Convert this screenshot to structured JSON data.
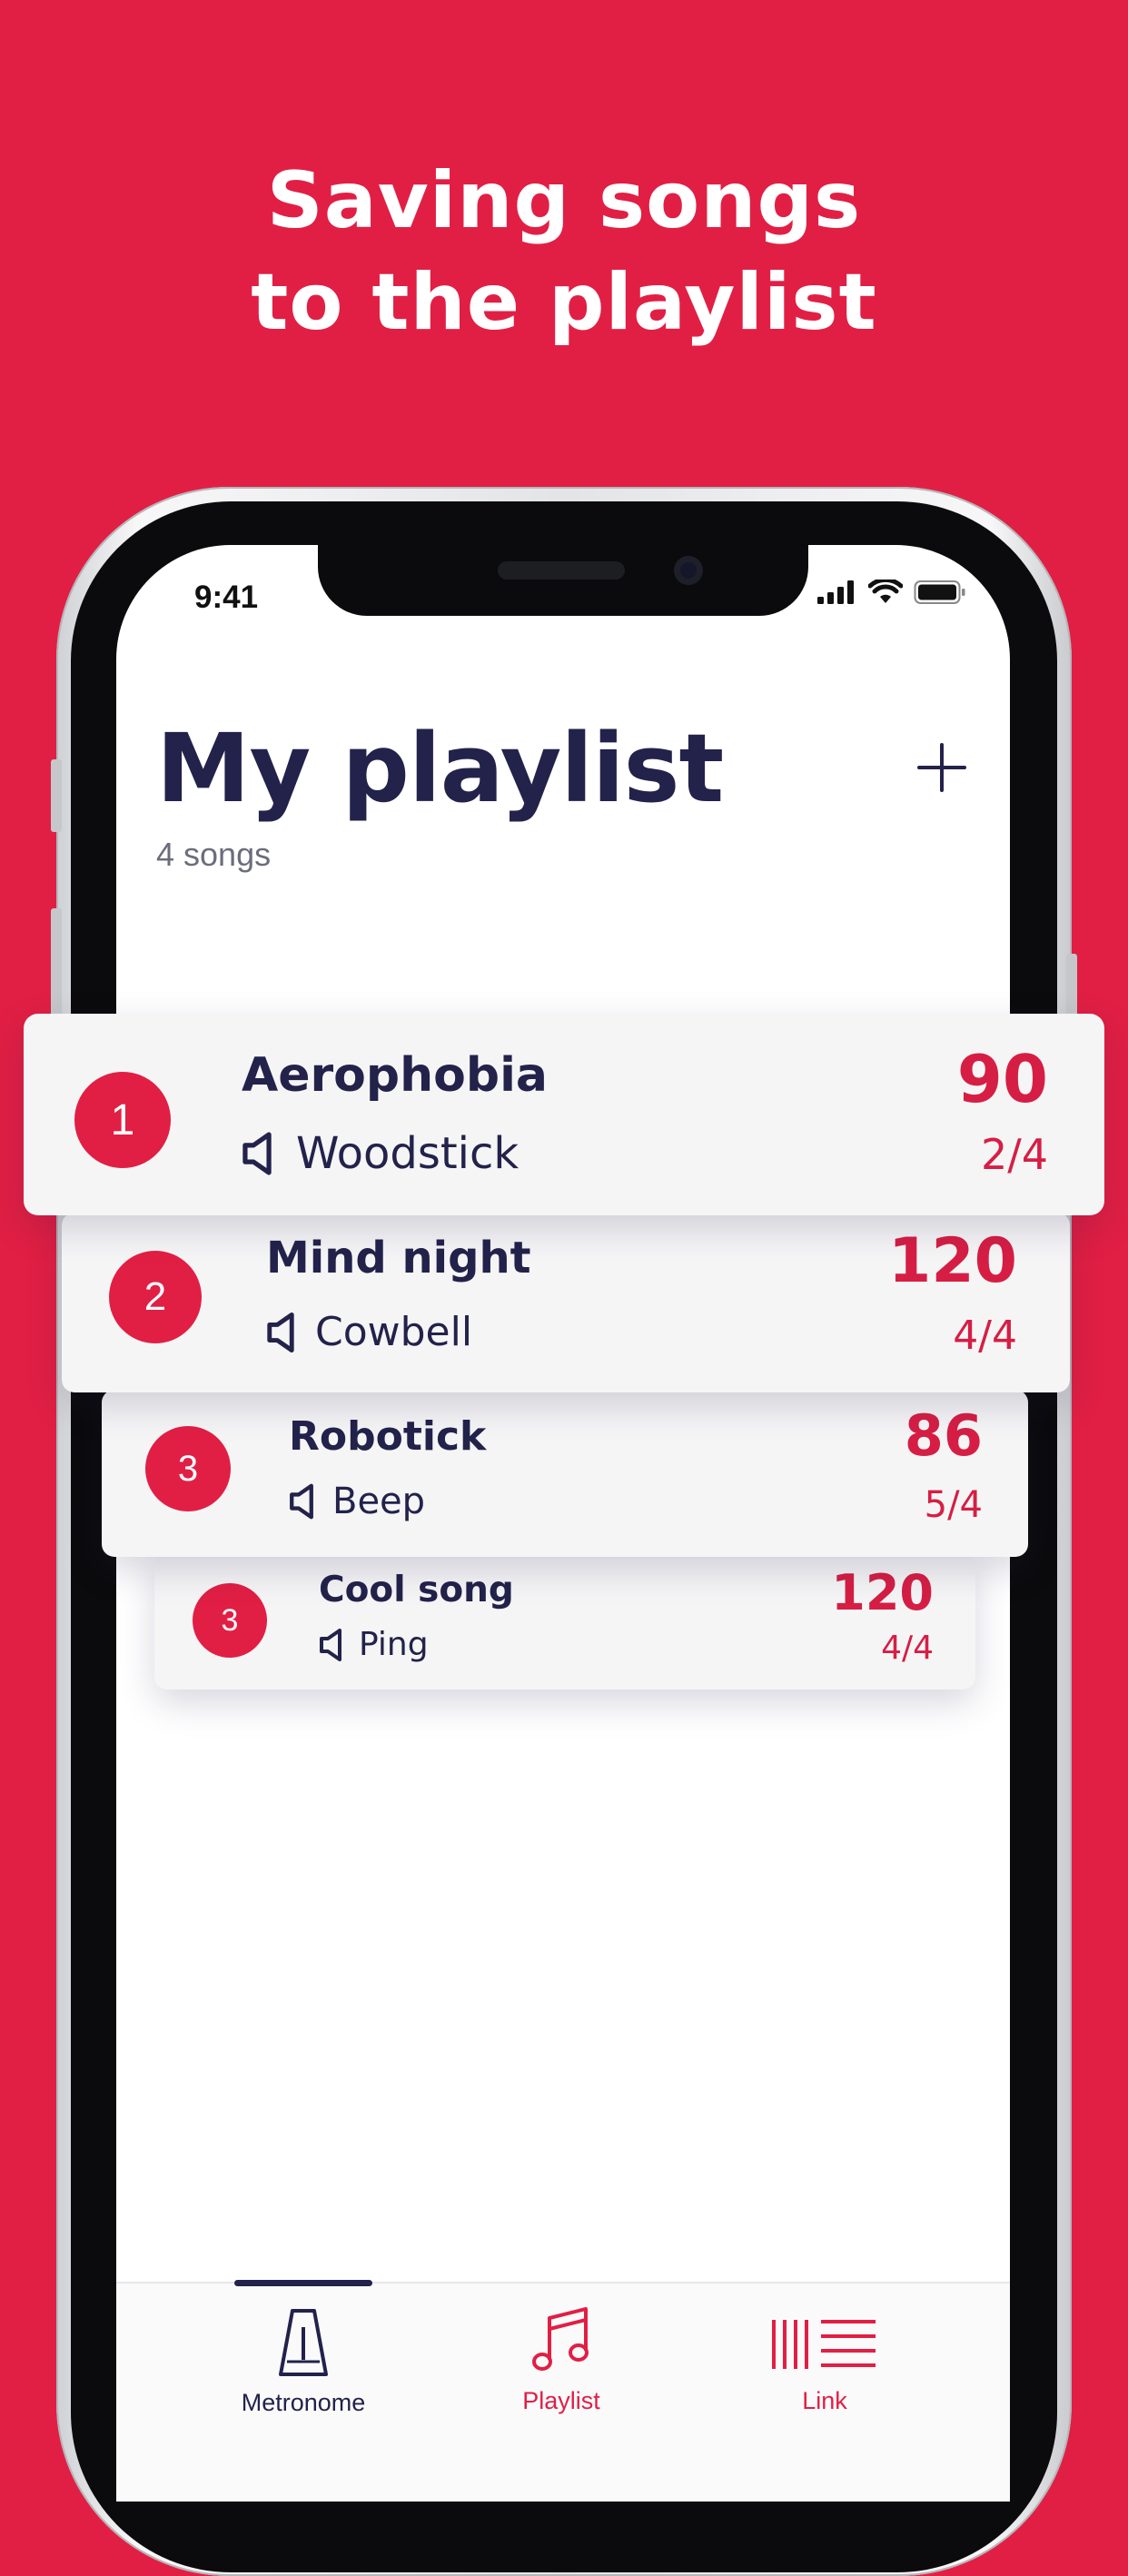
{
  "headline": {
    "line1": "Saving songs",
    "line2": "to the playlist"
  },
  "status_bar": {
    "time": "9:41"
  },
  "header": {
    "title": "My playlist",
    "subtitle": "4 songs"
  },
  "songs": [
    {
      "number": "1",
      "name": "Aerophobia",
      "sound": "Woodstick",
      "bpm": "90",
      "signature": "2/4"
    },
    {
      "number": "2",
      "name": "Mind night",
      "sound": "Cowbell",
      "bpm": "120",
      "signature": "4/4"
    },
    {
      "number": "3",
      "name": "Robotick",
      "sound": "Beep",
      "bpm": "86",
      "signature": "5/4"
    },
    {
      "number": "3",
      "name": "Cool song",
      "sound": "Ping",
      "bpm": "120",
      "signature": "4/4"
    }
  ],
  "tabs": [
    {
      "label": "Metronome",
      "icon": "metronome-icon",
      "active": true
    },
    {
      "label": "Playlist",
      "icon": "music-note-icon",
      "active": false
    },
    {
      "label": "Link",
      "icon": "link-bars-icon",
      "active": false
    }
  ],
  "colors": {
    "brand_red": "#E11F44",
    "navy": "#22224B",
    "background": "#FFFFFF"
  }
}
